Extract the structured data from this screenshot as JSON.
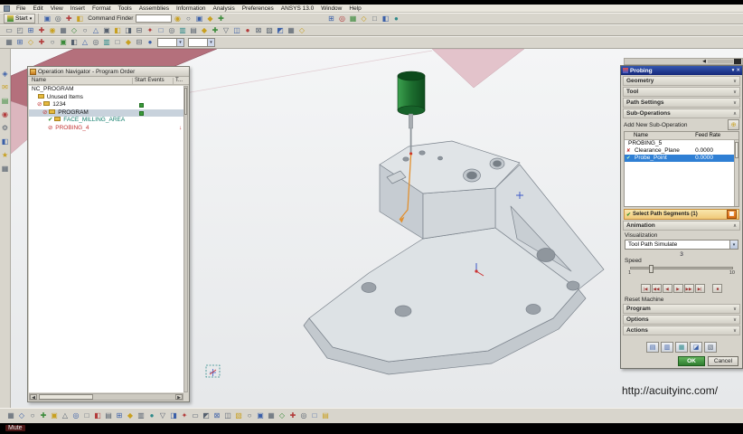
{
  "video": {
    "mute_label": "Mute"
  },
  "menubar": {
    "items": [
      "File",
      "Edit",
      "View",
      "Insert",
      "Format",
      "Tools",
      "Assemblies",
      "Information",
      "Analysis",
      "Preferences",
      "ANSYS 13.0",
      "Window",
      "Help"
    ]
  },
  "toolbar": {
    "start_label": "Start",
    "command_finder_label": "Command Finder"
  },
  "glyphs": {
    "chevron_down": "∨",
    "chevron_up": "∧",
    "dropdown_arrow": "▾",
    "left_arrow": "◀",
    "close": "✕",
    "check": "✔",
    "cross": "✘",
    "excluded": "⊘",
    "plus": "⊕",
    "alert_down": "↓",
    "search": "◉"
  },
  "navigator": {
    "title": "Operation Navigator - Program Order",
    "columns": {
      "name": "Name",
      "start_events": "Start Events",
      "t": "T..."
    },
    "rows": [
      {
        "label": "NC_PROGRAM"
      },
      {
        "label": "Unused Items"
      },
      {
        "label": "1234"
      },
      {
        "label": "PROGRAM"
      },
      {
        "label": "FACE_MILLING_AREA"
      },
      {
        "label": "PROBING_4"
      }
    ]
  },
  "probing": {
    "title": "Probing",
    "sections": {
      "geometry": "Geometry",
      "tool": "Tool",
      "path_settings": "Path Settings",
      "sub_operations": "Sub-Operations",
      "animation": "Animation",
      "program": "Program",
      "options": "Options",
      "actions": "Actions"
    },
    "add_new_sub_operation": "Add New Sub-Operation",
    "list": {
      "columns": {
        "name": "Name",
        "feed_rate": "Feed Rate"
      },
      "group": "PROBING_5",
      "rows": [
        {
          "name": "Clearance_Plane",
          "feed_rate": "0.0000"
        },
        {
          "name": "Probe_Point",
          "feed_rate": "0.0000"
        }
      ]
    },
    "select_path_segments": "Select Path Segments (1)",
    "visualization_label": "Visualization",
    "visualization_value": "Tool Path Simulate",
    "speed_label": "Speed",
    "speed_value": "3",
    "speed_min": "1",
    "speed_max": "10",
    "reset_machine_label": "Reset Machine",
    "ok_label": "OK",
    "cancel_label": "Cancel"
  },
  "watermark": "http://acuityinc.com/",
  "colors": {
    "selection_blue": "#2f7fd4",
    "segment_orange": "#e07820",
    "ok_green": "#3f9c3f",
    "tool_green": "#1e7a2e"
  },
  "icons": {
    "row1a": [
      "▣~#3a5fa8",
      "◎~#55606e",
      "✚~#b23a3a",
      "◧~#c8a020"
    ],
    "row1b": [
      "○~#55606e",
      "▣~#3a5fa8",
      "◆~#c8a020",
      "✚~#3a8a3a"
    ],
    "row1c": [
      "⊞~#3a5fa8",
      "◎~#b23a3a",
      "▦~#3a8a3a",
      "◇~#c8a020",
      "□~#55606e",
      "◧~#3a5fa8",
      "●~#2e8a8a"
    ],
    "row2": [
      "▭~#55606e",
      "◰~#55606e",
      "⊞~#3a5fa8",
      "✚~#b23a3a",
      "◉~#c8a020",
      "▦~#55606e",
      "◇~#3a8a3a",
      "○~#55606e",
      "△~#3a5fa8",
      "▣~#55606e",
      "◧~#c8a020",
      "◨~#55606e",
      "⊟~#55606e",
      "✦~#b23a3a",
      "□~#3a5fa8",
      "◎~#55606e",
      "▥~#2e8a8a",
      "▤~#55606e",
      "◆~#c8a020",
      "✚~#3a8a3a",
      "▽~#55606e",
      "◫~#3a5fa8",
      "●~#b23a3a",
      "⊠~#55606e",
      "▨~#55606e",
      "◩~#3a5fa8",
      "▦~#55606e",
      "◇~#c8a020"
    ],
    "row3": [
      "▦~#55606e",
      "⊞~#3a5fa8",
      "◇~#c8a020",
      "✚~#b23a3a",
      "○~#55606e",
      "▣~#3a8a3a",
      "◧~#55606e",
      "△~#3a5fa8",
      "◎~#55606e",
      "▥~#2e8a8a",
      "□~#55606e",
      "◆~#c8a020",
      "⊟~#55606e",
      "●~#3a5fa8"
    ],
    "left": [
      "◈~#3a5fa8",
      "✉~#c8a020",
      "▤~#3a8a3a",
      "◉~#b23a3a",
      "⚙~#55606e",
      "◧~#3a5fa8",
      "★~#c8a020",
      "▦~#55606e"
    ],
    "bottom": [
      "▦~#55606e",
      "◇~#3a5fa8",
      "○~#55606e",
      "✚~#3a8a3a",
      "▣~#c8a020",
      "△~#55606e",
      "◎~#3a5fa8",
      "□~#55606e",
      "◧~#b23a3a",
      "▤~#55606e",
      "⊞~#3a5fa8",
      "◆~#c8a020",
      "▥~#55606e",
      "●~#2e8a8a",
      "▽~#55606e",
      "◨~#3a5fa8",
      "✦~#b23a3a",
      "▭~#55606e",
      "◩~#55606e",
      "⊠~#3a5fa8",
      "◫~#55606e",
      "▧~#c8a020",
      "○~#55606e",
      "▣~#3a5fa8",
      "▦~#55606e",
      "◇~#3a8a3a",
      "✚~#b23a3a",
      "◎~#55606e",
      "□~#3a5fa8",
      "▤~#c8a020"
    ],
    "playback": [
      "|◀~#a03030",
      "◀◀~#a03030",
      "◀~#a03030",
      "▶~#a03030",
      "▶▶~#a03030",
      "▶|~#a03030"
    ],
    "actions": [
      "▤~#3a5fa8",
      "▥~#3a5fa8",
      "▦~#2e8a8a",
      "◪~#3a5fa8",
      "▧~#55606e"
    ]
  }
}
